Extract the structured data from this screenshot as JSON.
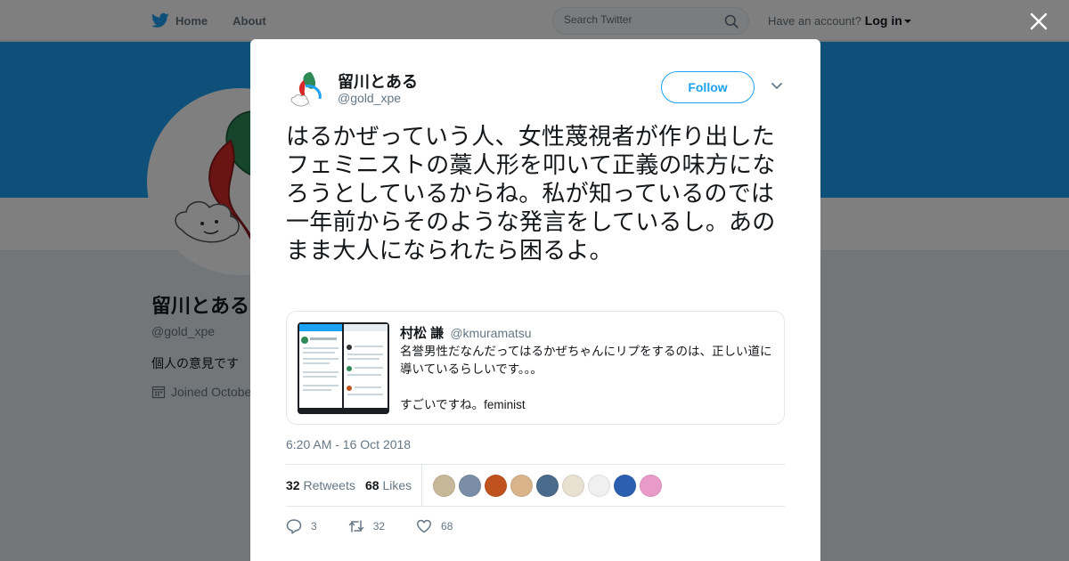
{
  "topbar": {
    "home_label": "Home",
    "about_label": "About",
    "search_placeholder": "Search Twitter",
    "account_prompt": "Have an account?",
    "login_label": "Log in"
  },
  "profile": {
    "name": "留川とある",
    "handle": "@gold_xpe",
    "bio": "個人の意見です",
    "joined": "Joined Octobe"
  },
  "tweet": {
    "author_name": "留川とある",
    "author_handle": "@gold_xpe",
    "follow_label": "Follow",
    "text": "はるかぜっていう人、女性蔑視者が作り出したフェミニストの藁人形を叩いて正義の味方になろうとしているからね。私が知っているのでは一年前からそのような発言をしているし。あのまま大人になられたら困るよ。",
    "quoted": {
      "name": "村松 謙",
      "handle": "@kmuramatsu",
      "text": "名誉男性だなんだってはるかぜちゃんにリプをするのは、正しい道に導いているらしいです。。。\n\nすごいですね。feminist"
    },
    "timestamp": "6:20 AM - 16 Oct 2018",
    "retweets_count": "32",
    "retweets_label": "Retweets",
    "likes_count": "68",
    "likes_label": "Likes",
    "reply_count": "3",
    "retweet_count": "32",
    "like_count": "68"
  },
  "likers": [
    {
      "name": "liker-1",
      "color": "#c8b89a"
    },
    {
      "name": "liker-2",
      "color": "#7a8ea8"
    },
    {
      "name": "liker-3",
      "color": "#c0521f"
    },
    {
      "name": "liker-4",
      "color": "#d9b48a"
    },
    {
      "name": "liker-5",
      "color": "#4a6b8c"
    },
    {
      "name": "liker-6",
      "color": "#e8e0d0"
    },
    {
      "name": "liker-7",
      "color": "#f0f0f0"
    },
    {
      "name": "liker-8",
      "color": "#2d5fb0"
    },
    {
      "name": "liker-9",
      "color": "#e89bc8"
    }
  ],
  "colors": {
    "brand": "#1da1f2",
    "text": "#14171a",
    "muted": "#657786"
  }
}
